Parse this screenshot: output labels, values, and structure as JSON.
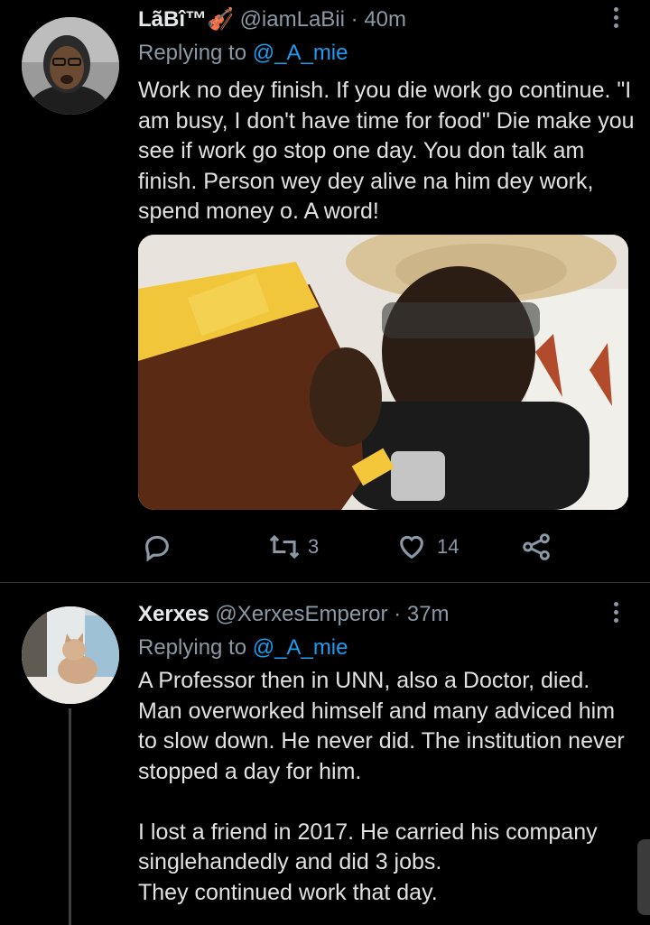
{
  "tweets": [
    {
      "name": "LãBî™🎻",
      "handle": "@iamLaBii",
      "time": "40m",
      "replying_prefix": "Replying to",
      "replying_to": "@_A_mie",
      "text": "Work no dey finish. If you die work go continue. \"I am busy, I don't have time for food\" Die make you see if work go stop one day. You don talk am finish. Person wey dey alive na him dey work, spend money o. A word!",
      "media_icon": "photo-icon",
      "actions": {
        "reply_count": "",
        "retweet_count": "3",
        "like_count": "14"
      }
    },
    {
      "name": "Xerxes",
      "handle": "@XerxesEmperor",
      "time": "37m",
      "replying_prefix": "Replying to",
      "replying_to": "@_A_mie",
      "text": "A Professor then in UNN, also a Doctor, died. Man overworked himself and many adviced him to slow down. He never did. The institution never stopped a day for him.\n\nI lost a friend in 2017. He carried his company singlehandedly and did 3 jobs.\nThey continued work that day."
    }
  ],
  "separator": "·",
  "colors": {
    "background": "#000000",
    "link": "#1d9bf0",
    "muted": "#8b98a5",
    "text": "#e1e1e1"
  }
}
